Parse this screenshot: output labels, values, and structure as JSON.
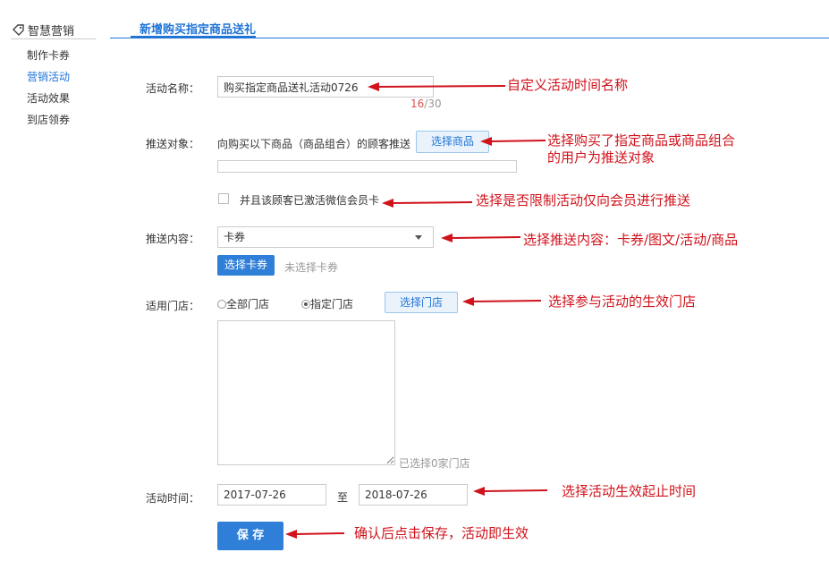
{
  "sidebar": {
    "title": "智慧营销",
    "items": [
      {
        "label": "制作卡券"
      },
      {
        "label": "营销活动"
      },
      {
        "label": "活动效果"
      },
      {
        "label": "到店领券"
      }
    ]
  },
  "header": {
    "title": "新增购买指定商品送礼"
  },
  "form": {
    "name": {
      "label": "活动名称：",
      "value": "购买指定商品送礼活动0726",
      "count_current": "16",
      "count_max": "/30"
    },
    "target": {
      "label": "推送对象：",
      "desc": "向购买以下商品（商品组合）的顾客推送",
      "button": "选择商品",
      "member_checkbox_label": "并且该顾客已激活微信会员卡"
    },
    "content": {
      "label": "推送内容：",
      "selected": "卡券",
      "button": "选择卡券",
      "status": "未选择卡券"
    },
    "stores": {
      "label": "适用门店：",
      "option_all": "全部门店",
      "option_specific": "指定门店",
      "selected_option": "指定门店",
      "button": "选择门店",
      "count_text": "已选择0家门店"
    },
    "time": {
      "label": "活动时间：",
      "start": "2017-07-26",
      "separator": "至",
      "end": "2018-07-26"
    },
    "save_button": "保 存"
  },
  "annotations": [
    {
      "text": "自定义活动时间名称"
    },
    {
      "text": "选择购买了指定商品或商品组合"
    },
    {
      "text": "的用户为推送对象"
    },
    {
      "text": "选择是否限制活动仅向会员进行推送"
    },
    {
      "text": "选择推送内容：卡券/图文/活动/商品"
    },
    {
      "text": "选择参与活动的生效门店"
    },
    {
      "text": "选择活动生效起止时间"
    },
    {
      "text": "确认后点击保存，活动即生效"
    }
  ],
  "colors": {
    "accent": "#1f74d6",
    "annotation": "#d0121b",
    "counter": "#d9534f"
  }
}
